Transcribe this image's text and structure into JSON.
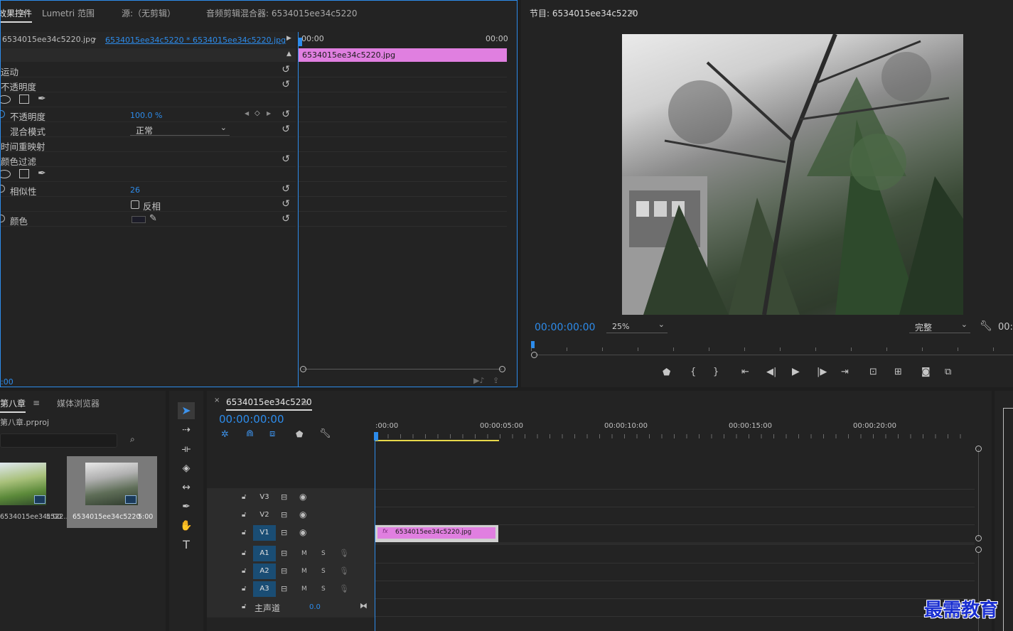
{
  "effect_controls": {
    "tabs": [
      "效果控件",
      "Lumetri 范围",
      "源:（无剪辑）",
      "音频剪辑混合器: 6534015ee34c5220"
    ],
    "source_clip": "6534015ee34c5220.jpg",
    "sequence_clip": "6534015ee34c5220 * 6534015ee34c5220.jpg",
    "time_start": "00:00",
    "time_end": "00:00",
    "timeline_clip": "6534015ee34c5220.jpg",
    "current_time": ":00",
    "rows": {
      "motion": "运动",
      "opacity_group": "不透明度",
      "opacity": "不透明度",
      "opacity_value": "100.0 %",
      "blend_mode": "混合模式",
      "blend_value": "正常",
      "time_remap": "时间重映射",
      "color_key": "颜色过滤",
      "similarity": "相似性",
      "similarity_value": "26",
      "invert": "反相",
      "color": "颜色"
    }
  },
  "program_monitor": {
    "title": "节目: 6534015ee34c5220",
    "timecode": "00:00:00:00",
    "zoom": "25%",
    "quality": "完整",
    "timecode_right": "00:"
  },
  "project": {
    "tabs": [
      "第八章",
      "媒体浏览器"
    ],
    "project_file": "第八章.prproj",
    "items": [
      {
        "name": "6534015ee34c522...",
        "duration": "5:00"
      },
      {
        "name": "6534015ee34c5220",
        "duration": "5:00"
      }
    ]
  },
  "timeline": {
    "sequence_name": "6534015ee34c5220",
    "timecode": "00:00:00:00",
    "ruler": [
      ":00:00",
      "00:00:05:00",
      "00:00:10:00",
      "00:00:15:00",
      "00:00:20:00"
    ],
    "tracks_video": [
      "V3",
      "V2",
      "V1"
    ],
    "tracks_audio": [
      "A1",
      "A2",
      "A3"
    ],
    "master": "主声道",
    "master_value": "0.0",
    "clip_label": "6534015ee34c5220.jpg",
    "mute": "M",
    "solo": "S",
    "fx": "fx"
  },
  "watermark": "最需教育"
}
